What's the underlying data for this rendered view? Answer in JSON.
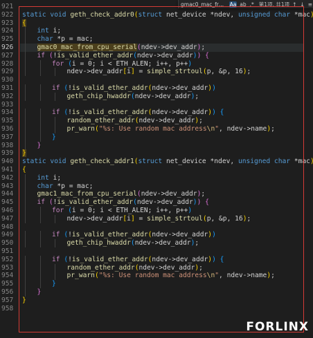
{
  "find_widget": {
    "query": "gmac0_mac_from_cpu_s",
    "match_case": "Aa",
    "whole_word": "ab",
    "regex": ".*",
    "results": "第1项, 共1项",
    "prev": "↑",
    "next": "↓",
    "menu": "≡"
  },
  "watermark": "FORLINX",
  "lines": [
    {
      "n": "921",
      "i": 0,
      "t": []
    },
    {
      "n": "922",
      "i": 0,
      "t": [
        [
          "static void ",
          "kw"
        ],
        [
          "geth_check_addr0",
          "fn"
        ],
        [
          "(",
          "br1"
        ],
        [
          "struct ",
          "kw"
        ],
        [
          "net_device ",
          ""
        ],
        [
          "*",
          ""
        ],
        [
          "ndev",
          ""
        ],
        [
          ", ",
          ""
        ],
        [
          "unsigned char ",
          "kw"
        ],
        [
          "*",
          ""
        ],
        [
          "mac",
          ""
        ],
        [
          ")",
          "br1"
        ]
      ]
    },
    {
      "n": "923",
      "i": 0,
      "t": [
        [
          "{",
          "br1 hl"
        ]
      ]
    },
    {
      "n": "924",
      "i": 1,
      "t": [
        [
          "int ",
          "kw"
        ],
        [
          "i",
          ""
        ],
        [
          ";",
          ""
        ]
      ]
    },
    {
      "n": "925",
      "i": 1,
      "t": [
        [
          "char ",
          "kw"
        ],
        [
          "*p = mac;",
          ""
        ]
      ]
    },
    {
      "n": "926",
      "i": 1,
      "active": true,
      "t": [
        [
          "gmac0_mac_from_cpu_serial",
          "fn hl"
        ],
        [
          "(",
          "br2"
        ],
        [
          "ndev->dev_addr",
          ""
        ],
        [
          ")",
          "br2"
        ],
        [
          ";",
          ""
        ]
      ]
    },
    {
      "n": "927",
      "i": 1,
      "t": [
        [
          "if ",
          "ctl"
        ],
        [
          "(",
          "br2"
        ],
        [
          "!",
          ""
        ],
        [
          "is_valid_ether_addr",
          "fn"
        ],
        [
          "(",
          "br3"
        ],
        [
          "ndev->dev_addr",
          ""
        ],
        [
          ")",
          "br3"
        ],
        [
          ")",
          "br2"
        ],
        [
          " ",
          ""
        ],
        [
          "{",
          "br2"
        ]
      ]
    },
    {
      "n": "928",
      "i": 2,
      "t": [
        [
          "for ",
          "ctl"
        ],
        [
          "(",
          "br3"
        ],
        [
          "i = ",
          ""
        ],
        [
          "0",
          ""
        ],
        [
          "; i < ",
          ""
        ],
        [
          "ETH_ALEN",
          ""
        ],
        [
          "; i++, p++",
          ""
        ],
        [
          ")",
          "br3"
        ]
      ]
    },
    {
      "n": "929",
      "i": 3,
      "t": [
        [
          "ndev->dev_addr",
          ""
        ],
        [
          "[",
          "br1"
        ],
        [
          "i",
          ""
        ],
        [
          "]",
          "br1"
        ],
        [
          " = ",
          ""
        ],
        [
          "simple_strtoul",
          "fn"
        ],
        [
          "(",
          "br1"
        ],
        [
          "p, &p, ",
          ""
        ],
        [
          "16",
          ""
        ],
        [
          ")",
          "br1"
        ],
        [
          ";",
          ""
        ]
      ]
    },
    {
      "n": "930",
      "i": 0,
      "t": []
    },
    {
      "n": "931",
      "i": 2,
      "t": [
        [
          "if ",
          "ctl"
        ],
        [
          "(",
          "br3"
        ],
        [
          "!",
          ""
        ],
        [
          "is_valid_ether_addr",
          "fn"
        ],
        [
          "(",
          "br1"
        ],
        [
          "ndev->dev_addr",
          ""
        ],
        [
          ")",
          "br1"
        ],
        [
          ")",
          "br3"
        ]
      ]
    },
    {
      "n": "932",
      "i": 3,
      "t": [
        [
          "geth_chip_hwaddr",
          "fn"
        ],
        [
          "(",
          "br3"
        ],
        [
          "ndev->dev_addr",
          ""
        ],
        [
          ")",
          "br3"
        ],
        [
          ";",
          ""
        ]
      ]
    },
    {
      "n": "933",
      "i": 0,
      "t": []
    },
    {
      "n": "934",
      "i": 2,
      "t": [
        [
          "if ",
          "ctl"
        ],
        [
          "(",
          "br3"
        ],
        [
          "!",
          ""
        ],
        [
          "is_valid_ether_addr",
          "fn"
        ],
        [
          "(",
          "br1"
        ],
        [
          "ndev->dev_addr",
          ""
        ],
        [
          ")",
          "br1"
        ],
        [
          ")",
          "br3"
        ],
        [
          " ",
          ""
        ],
        [
          "{",
          "br3"
        ]
      ]
    },
    {
      "n": "935",
      "i": 3,
      "t": [
        [
          "random_ether_addr",
          "fn"
        ],
        [
          "(",
          "br1"
        ],
        [
          "ndev->dev_addr",
          ""
        ],
        [
          ")",
          "br1"
        ],
        [
          ";",
          ""
        ]
      ]
    },
    {
      "n": "936",
      "i": 3,
      "t": [
        [
          "pr_warn",
          "fn"
        ],
        [
          "(",
          "br1"
        ],
        [
          "\"%s: Use random mac address",
          "str"
        ],
        [
          "\\n",
          "esc"
        ],
        [
          "\"",
          "str"
        ],
        [
          ", ndev->name",
          ""
        ],
        [
          ")",
          "br1"
        ],
        [
          ";",
          ""
        ]
      ]
    },
    {
      "n": "937",
      "i": 2,
      "t": [
        [
          "}",
          "br3"
        ]
      ]
    },
    {
      "n": "938",
      "i": 1,
      "t": [
        [
          "}",
          "br2"
        ]
      ]
    },
    {
      "n": "939",
      "i": 0,
      "t": [
        [
          "}",
          "br1 hl"
        ]
      ]
    },
    {
      "n": "940",
      "i": 0,
      "t": [
        [
          "static void ",
          "kw"
        ],
        [
          "geth_check_addr1",
          "fn"
        ],
        [
          "(",
          "br1"
        ],
        [
          "struct ",
          "kw"
        ],
        [
          "net_device ",
          ""
        ],
        [
          "*",
          ""
        ],
        [
          "ndev",
          ""
        ],
        [
          ", ",
          ""
        ],
        [
          "unsigned char ",
          "kw"
        ],
        [
          "*",
          ""
        ],
        [
          "mac",
          ""
        ],
        [
          ")",
          "br1"
        ]
      ]
    },
    {
      "n": "941",
      "i": 0,
      "t": [
        [
          "{",
          "br1"
        ]
      ]
    },
    {
      "n": "942",
      "i": 1,
      "t": [
        [
          "int ",
          "kw"
        ],
        [
          "i",
          ""
        ],
        [
          ";",
          ""
        ]
      ]
    },
    {
      "n": "943",
      "i": 1,
      "t": [
        [
          "char ",
          "kw"
        ],
        [
          "*p = mac;",
          ""
        ]
      ]
    },
    {
      "n": "944",
      "i": 1,
      "t": [
        [
          "gmac1_mac_from_cpu_serial",
          "fn"
        ],
        [
          "(",
          "br2"
        ],
        [
          "ndev->dev_addr",
          ""
        ],
        [
          ")",
          "br2"
        ],
        [
          ";",
          ""
        ]
      ]
    },
    {
      "n": "945",
      "i": 1,
      "t": [
        [
          "if ",
          "ctl"
        ],
        [
          "(",
          "br2"
        ],
        [
          "!",
          ""
        ],
        [
          "is_valid_ether_addr",
          "fn"
        ],
        [
          "(",
          "br3"
        ],
        [
          "ndev->dev_addr",
          ""
        ],
        [
          ")",
          "br3"
        ],
        [
          ")",
          "br2"
        ],
        [
          " ",
          ""
        ],
        [
          "{",
          "br2"
        ]
      ]
    },
    {
      "n": "946",
      "i": 2,
      "t": [
        [
          "for ",
          "ctl"
        ],
        [
          "(",
          "br3"
        ],
        [
          "i = ",
          ""
        ],
        [
          "0",
          ""
        ],
        [
          "; i < ",
          ""
        ],
        [
          "ETH_ALEN",
          ""
        ],
        [
          "; i++, p++",
          ""
        ],
        [
          ")",
          "br3"
        ]
      ]
    },
    {
      "n": "947",
      "i": 3,
      "t": [
        [
          "ndev->dev_addr",
          ""
        ],
        [
          "[",
          "br1"
        ],
        [
          "i",
          ""
        ],
        [
          "]",
          "br1"
        ],
        [
          " = ",
          ""
        ],
        [
          "simple_strtoul",
          "fn"
        ],
        [
          "(",
          "br1"
        ],
        [
          "p, &p, ",
          ""
        ],
        [
          "16",
          ""
        ],
        [
          ")",
          "br1"
        ],
        [
          ";",
          ""
        ]
      ]
    },
    {
      "n": "948",
      "i": 0,
      "t": []
    },
    {
      "n": "949",
      "i": 2,
      "t": [
        [
          "if ",
          "ctl"
        ],
        [
          "(",
          "br3"
        ],
        [
          "!",
          ""
        ],
        [
          "is_valid_ether_addr",
          "fn"
        ],
        [
          "(",
          "br1"
        ],
        [
          "ndev->dev_addr",
          ""
        ],
        [
          ")",
          "br1"
        ],
        [
          ")",
          "br3"
        ]
      ]
    },
    {
      "n": "950",
      "i": 3,
      "t": [
        [
          "geth_chip_hwaddr",
          "fn"
        ],
        [
          "(",
          "br3"
        ],
        [
          "ndev->dev_addr",
          ""
        ],
        [
          ")",
          "br3"
        ],
        [
          ";",
          ""
        ]
      ]
    },
    {
      "n": "951",
      "i": 0,
      "t": []
    },
    {
      "n": "952",
      "i": 2,
      "t": [
        [
          "if ",
          "ctl"
        ],
        [
          "(",
          "br3"
        ],
        [
          "!",
          ""
        ],
        [
          "is_valid_ether_addr",
          "fn"
        ],
        [
          "(",
          "br1"
        ],
        [
          "ndev->dev_addr",
          ""
        ],
        [
          ")",
          "br1"
        ],
        [
          ")",
          "br3"
        ],
        [
          " ",
          ""
        ],
        [
          "{",
          "br3"
        ]
      ]
    },
    {
      "n": "953",
      "i": 3,
      "t": [
        [
          "random_ether_addr",
          "fn"
        ],
        [
          "(",
          "br1"
        ],
        [
          "ndev->dev_addr",
          ""
        ],
        [
          ")",
          "br1"
        ],
        [
          ";",
          ""
        ]
      ]
    },
    {
      "n": "954",
      "i": 3,
      "t": [
        [
          "pr_warn",
          "fn"
        ],
        [
          "(",
          "br1"
        ],
        [
          "\"%s: Use random mac address",
          "str"
        ],
        [
          "\\n",
          "esc"
        ],
        [
          "\"",
          "str"
        ],
        [
          ", ndev->name",
          ""
        ],
        [
          ")",
          "br1"
        ],
        [
          ";",
          ""
        ]
      ]
    },
    {
      "n": "955",
      "i": 2,
      "t": [
        [
          "}",
          "br3"
        ]
      ]
    },
    {
      "n": "956",
      "i": 1,
      "t": [
        [
          "}",
          "br2"
        ]
      ]
    },
    {
      "n": "957",
      "i": 0,
      "t": [
        [
          "}",
          "br1"
        ]
      ]
    },
    {
      "n": "958",
      "i": 0,
      "t": []
    }
  ]
}
